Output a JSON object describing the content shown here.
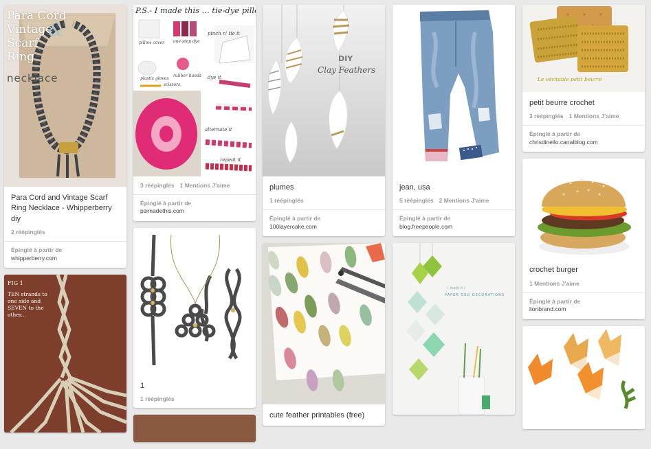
{
  "pins": {
    "necklace": {
      "img_title": [
        "Para Cord",
        "Vintage",
        "Scarf",
        "Ring"
      ],
      "img_amp": "&",
      "img_sub": "necklace",
      "desc": "Para Cord and Vintage Scarf Ring Necklace - Whipperberry diy",
      "repins": "2 rèépinglés",
      "source_label": "Épinglé à partir de",
      "source": "whipperberry.com"
    },
    "braid": {
      "img_fig": "FIG 1",
      "img_text": "TEN strands to one side and SEVEN to the other..."
    },
    "pillow": {
      "img_title": "P.S.- I made this ... tie-dye pillow",
      "labels": [
        "pillow cover",
        "one-step dye",
        "plastic gloves",
        "rubber bands",
        "scissors",
        "pinch n' tie it",
        "dye it",
        "alternate it",
        "repeat it"
      ],
      "repins": "3 rèépinglés",
      "likes": "1 Mentions J'aime",
      "source_label": "Épinglé à partir de",
      "source": "psimadethis.com"
    },
    "jewelry": {
      "desc": "1",
      "repins": "1 rèépinglés"
    },
    "feathers": {
      "img_diy": "DIY",
      "img_sub": "Clay Feathers",
      "desc": "plumes",
      "repins": "1 rèépinglés",
      "source_label": "Épinglé à partir de",
      "source": "100layercake.com"
    },
    "printables": {
      "desc": "cute feather printables (free)"
    },
    "jeans": {
      "desc": "jean, usa",
      "repins": "5 rèépinglés",
      "likes": "2 Mentions J'aime",
      "source_label": "Épinglé à partir de",
      "source": "blog.freepeople.com"
    },
    "geo": {
      "img_caption1": "( make it )",
      "img_caption2": "PAPER GEO DECORATIONS"
    },
    "beurre": {
      "img_caption": "Le véritable petit beurre",
      "desc": "petit beurre crochet",
      "repins": "3 rèépinglés",
      "likes": "1 Mentions J'aime",
      "source_label": "Épinglé à partir de",
      "source": "chrisdinello.canalblog.com"
    },
    "burger": {
      "desc": "crochet burger",
      "likes": "1 Mentions J'aime",
      "source_label": "Épinglé à partir de",
      "source": "lionbrand.com"
    },
    "fox": {}
  },
  "colors": {
    "background": "#e9e9e9",
    "card": "#ffffff",
    "muted_text": "#999999",
    "domain_text": "#444444"
  }
}
